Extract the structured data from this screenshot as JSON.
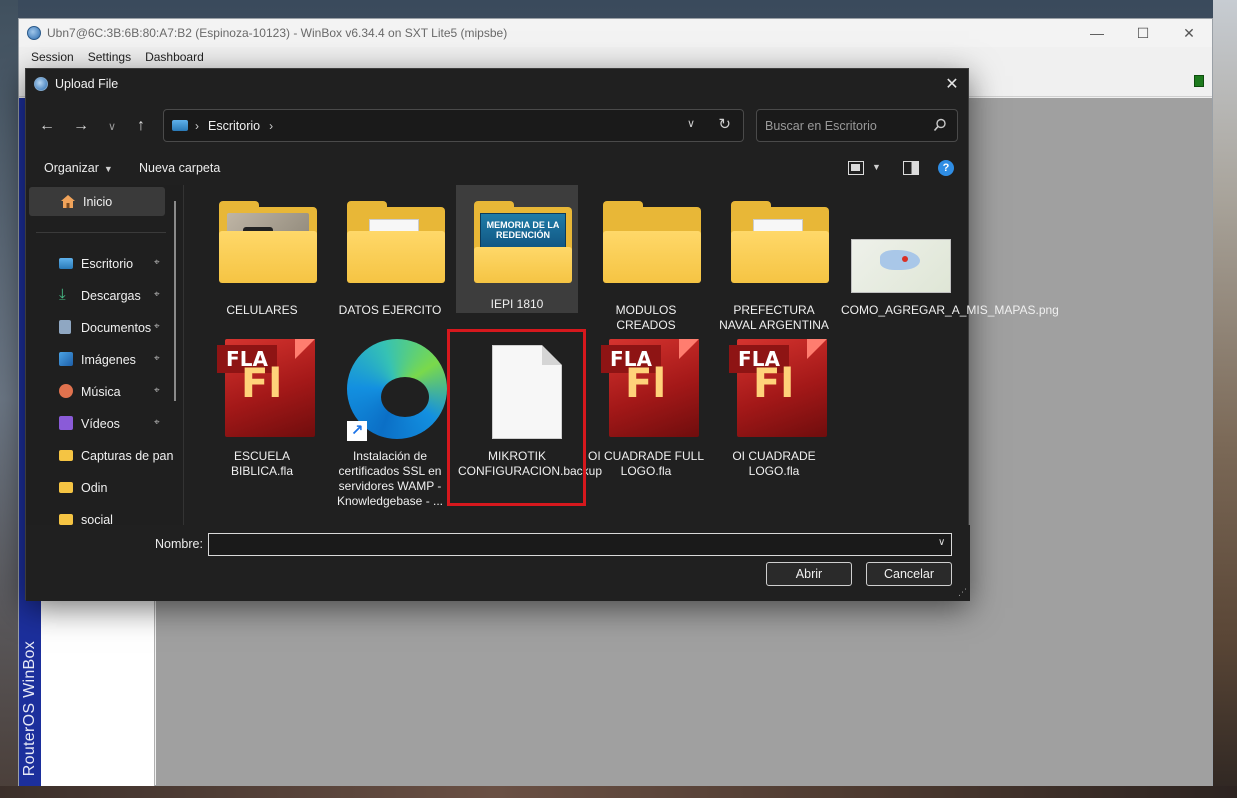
{
  "winbox": {
    "title": "Ubn7@6C:3B:6B:80:A7:B2 (Espinoza-10123) - WinBox v6.34.4 on SXT Lite5 (mipsbe)",
    "menu": [
      "Session",
      "Settings",
      "Dashboard"
    ],
    "side_label": "RouterOS WinBox"
  },
  "dialog": {
    "title": "Upload File",
    "address": {
      "location": "Escritorio"
    },
    "search": {
      "placeholder": "Buscar en Escritorio"
    },
    "commands": {
      "organize": "Organizar",
      "new_folder": "Nueva carpeta"
    },
    "nav": {
      "home": "Inicio",
      "items": [
        {
          "label": "Escritorio",
          "icon": "desktop-icon",
          "pinned": true
        },
        {
          "label": "Descargas",
          "icon": "download-icon",
          "pinned": true
        },
        {
          "label": "Documentos",
          "icon": "documents-icon",
          "pinned": true
        },
        {
          "label": "Imágenes",
          "icon": "pictures-icon",
          "pinned": true
        },
        {
          "label": "Música",
          "icon": "music-icon",
          "pinned": true
        },
        {
          "label": "Vídeos",
          "icon": "videos-icon",
          "pinned": true
        },
        {
          "label": "Capturas de pan",
          "icon": "folder-icon",
          "pinned": false
        },
        {
          "label": "Odin",
          "icon": "folder-icon",
          "pinned": false
        },
        {
          "label": "social",
          "icon": "folder-icon",
          "pinned": false
        }
      ]
    },
    "files": [
      {
        "name": "CELULARES",
        "type": "folder"
      },
      {
        "name": "DATOS EJERCITO",
        "type": "folder"
      },
      {
        "name": "IEPI 1810",
        "type": "folder",
        "selected": true,
        "thumb_text": "MEMORIA DE LA REDENCIÓN"
      },
      {
        "name": "MODULOS CREADOS",
        "type": "folder"
      },
      {
        "name": "PREFECTURA NAVAL ARGENTINA",
        "type": "folder"
      },
      {
        "name": "COMO_AGREGAR_A_MIS_MAPAS.png",
        "type": "png"
      },
      {
        "name": "ESCUELA BIBLICA.fla",
        "type": "fla"
      },
      {
        "name": "Instalación de certificados SSL en servidores WAMP - Knowledgebase - ...",
        "type": "shortcut"
      },
      {
        "name": "MIKROTIK CONFIGURACION.backup",
        "type": "file",
        "highlighted": true
      },
      {
        "name": "OI CUADRADE FULL LOGO.fla",
        "type": "fla"
      },
      {
        "name": "OI CUADRADE LOGO.fla",
        "type": "fla"
      }
    ],
    "fla_badge": "FLA",
    "fla_mark": "Fl",
    "footer": {
      "name_label": "Nombre:",
      "name_value": "",
      "open_button": "Abrir",
      "cancel_button": "Cancelar"
    }
  },
  "colors": {
    "dialog_bg": "#202020",
    "highlight_border": "#d6181d",
    "winbox_strip": "#1c2f9c",
    "folder": "#f5c443"
  }
}
